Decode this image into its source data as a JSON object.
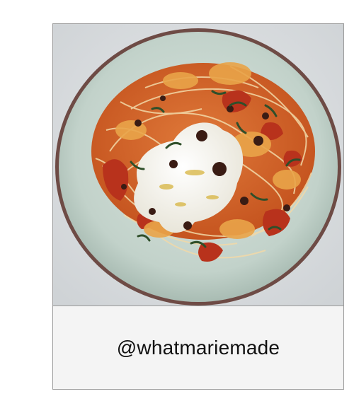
{
  "post": {
    "image": {
      "subject": "plate-of-spaghetti-with-burrata-and-tomatoes",
      "colors": {
        "background": "#d9dcde",
        "plate_rim": "#6e4b45",
        "plate": "#c9d6d0",
        "sauce": "#d2652d",
        "burrata": "#f4f2ea",
        "basil": "#2f4f2a"
      }
    },
    "caption": {
      "handle": "@whatmariemade"
    }
  }
}
